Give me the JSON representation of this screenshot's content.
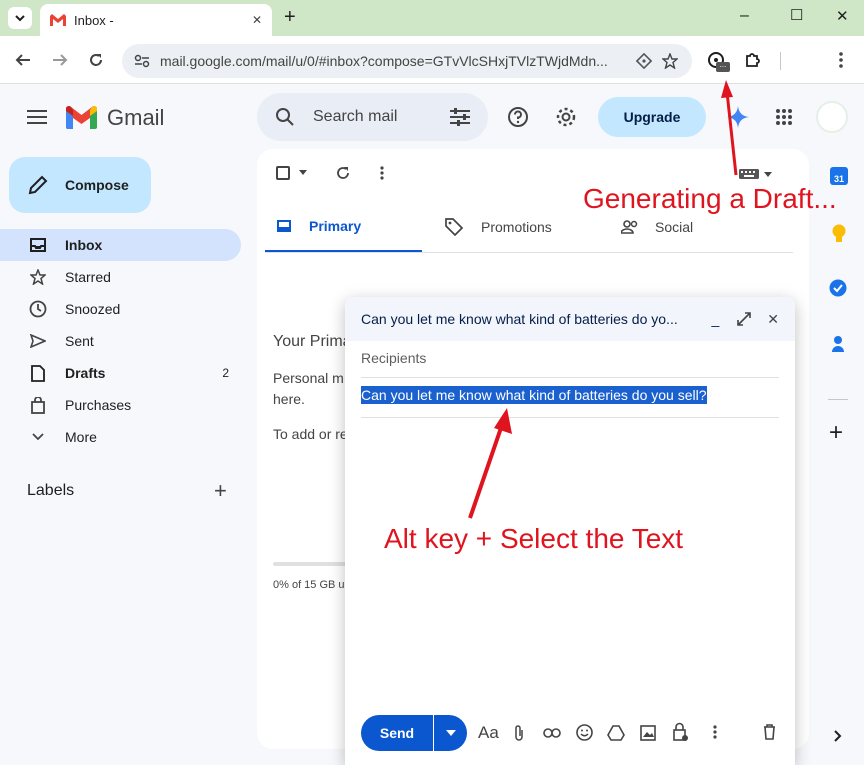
{
  "browser": {
    "tab_title": "Inbox - ",
    "new_tab_symbol": "+",
    "url": "mail.google.com/mail/u/0/#inbox?compose=GTvVlcSHxjTVlzTWjdMdn...",
    "window_controls": {
      "minimize": "–",
      "maximize": "☐",
      "close": "✕"
    }
  },
  "gmail": {
    "logo_text": "Gmail",
    "search_placeholder": "Search mail",
    "upgrade_label": "Upgrade",
    "compose_label": "Compose",
    "nav": [
      {
        "label": "Inbox",
        "count": ""
      },
      {
        "label": "Starred",
        "count": ""
      },
      {
        "label": "Snoozed",
        "count": ""
      },
      {
        "label": "Sent",
        "count": ""
      },
      {
        "label": "Drafts",
        "count": "2"
      },
      {
        "label": "Purchases",
        "count": ""
      },
      {
        "label": "More",
        "count": ""
      }
    ],
    "labels_heading": "Labels",
    "tabs": [
      {
        "label": "Primary"
      },
      {
        "label": "Promotions"
      },
      {
        "label": "Social"
      }
    ],
    "empty_title": "Your Prima",
    "empty_line1": "Personal m",
    "empty_line2": "here.",
    "empty_line3": "To add or re",
    "storage_text": "0% of 15 GB u"
  },
  "compose_window": {
    "subject_title": "Can you let me know what kind of batteries do yo...",
    "recipients_placeholder": "Recipients",
    "subject_text": "Can you let me know what kind of batteries do you sell?",
    "send_label": "Send",
    "format_label": "Aa"
  },
  "annotations": {
    "top": "Generating a Draft...",
    "middle": "Alt key + Select the Text",
    "color": "#e0141e"
  },
  "side_panel_badge": "31"
}
